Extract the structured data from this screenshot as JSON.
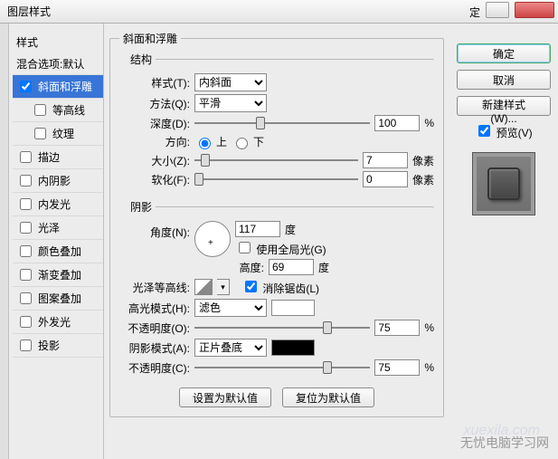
{
  "title": "图层样式",
  "titlebar_extra": "定",
  "sidebar": {
    "header": "样式",
    "items": [
      {
        "label": "混合选项:默认",
        "checked": false,
        "selected": false,
        "child": false,
        "nocb": true
      },
      {
        "label": "斜面和浮雕",
        "checked": true,
        "selected": true,
        "child": false
      },
      {
        "label": "等高线",
        "checked": false,
        "selected": false,
        "child": true
      },
      {
        "label": "纹理",
        "checked": false,
        "selected": false,
        "child": true
      },
      {
        "label": "描边",
        "checked": false,
        "selected": false,
        "child": false
      },
      {
        "label": "内阴影",
        "checked": false,
        "selected": false,
        "child": false
      },
      {
        "label": "内发光",
        "checked": false,
        "selected": false,
        "child": false
      },
      {
        "label": "光泽",
        "checked": false,
        "selected": false,
        "child": false
      },
      {
        "label": "颜色叠加",
        "checked": false,
        "selected": false,
        "child": false
      },
      {
        "label": "渐变叠加",
        "checked": false,
        "selected": false,
        "child": false
      },
      {
        "label": "图案叠加",
        "checked": false,
        "selected": false,
        "child": false
      },
      {
        "label": "外发光",
        "checked": false,
        "selected": false,
        "child": false
      },
      {
        "label": "投影",
        "checked": false,
        "selected": false,
        "child": false
      }
    ]
  },
  "panel": {
    "title": "斜面和浮雕",
    "structure": {
      "legend": "结构",
      "style_label": "样式(T):",
      "style_value": "内斜面",
      "method_label": "方法(Q):",
      "method_value": "平滑",
      "depth_label": "深度(D):",
      "depth_value": "100",
      "percent": "%",
      "direction_label": "方向:",
      "up": "上",
      "down": "下",
      "size_label": "大小(Z):",
      "size_value": "7",
      "px": "像素",
      "soften_label": "软化(F):",
      "soften_value": "0"
    },
    "shading": {
      "legend": "阴影",
      "angle_label": "角度(N):",
      "angle_value": "117",
      "deg": "度",
      "global_label": "使用全局光(G)",
      "altitude_label": "高度:",
      "altitude_value": "69",
      "gloss_label": "光泽等高线:",
      "antialias_label": "消除锯齿(L)",
      "highlight_mode_label": "高光模式(H):",
      "highlight_mode_value": "滤色",
      "highlight_opacity_label": "不透明度(O):",
      "highlight_opacity_value": "75",
      "shadow_mode_label": "阴影模式(A):",
      "shadow_mode_value": "正片叠底",
      "shadow_opacity_label": "不透明度(C):",
      "shadow_opacity_value": "75"
    },
    "buttons": {
      "make_default": "设置为默认值",
      "reset_default": "复位为默认值"
    }
  },
  "right": {
    "ok": "确定",
    "cancel": "取消",
    "newstyle": "新建样式(W)...",
    "preview_label": "预览(V)",
    "preview_checked": true
  },
  "watermark": {
    "a": "无忧电脑学习网",
    "b": "xuexila.com"
  }
}
